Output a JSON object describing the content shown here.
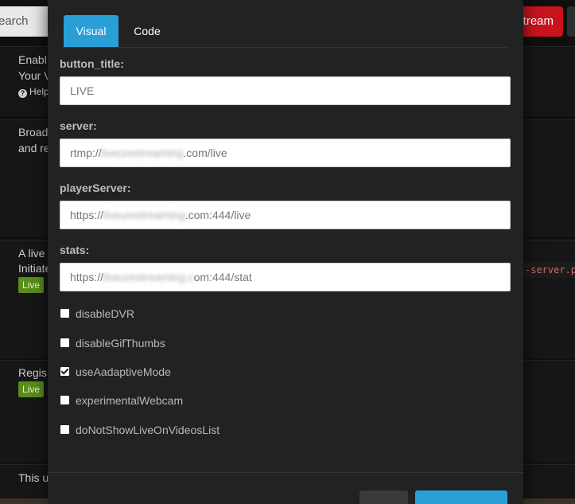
{
  "background": {
    "search_text": "earch",
    "stream_button": "tream",
    "panels": [
      {
        "lines": [
          "Enabl",
          "Your V"
        ],
        "help": "Help"
      },
      {
        "lines": [
          "Broad",
          "and re"
        ]
      },
      {
        "lines": [
          "A live",
          "Initiate"
        ],
        "badge": "Live"
      },
      {
        "lines": [
          "Regis"
        ],
        "badge": "Live"
      },
      {
        "lines": [
          "This u"
        ]
      }
    ],
    "code_snippet": "-server.p"
  },
  "modal": {
    "tabs": [
      {
        "label": "Visual",
        "active": true
      },
      {
        "label": "Code",
        "active": false
      }
    ],
    "fields": [
      {
        "label": "button_title:",
        "prefix": "LIVE",
        "blurred": "",
        "suffix": ""
      },
      {
        "label": "server:",
        "prefix": "rtmp://",
        "blurred": "liveurestreaming",
        "suffix": ".com/live"
      },
      {
        "label": "playerServer:",
        "prefix": "https://",
        "blurred": "liveurestreaming",
        "suffix": ".com:444/live"
      },
      {
        "label": "stats:",
        "prefix": "https://",
        "blurred": "liveurestreaming.c",
        "suffix": "om:444/stat"
      }
    ],
    "checkboxes": [
      {
        "label": "disableDVR",
        "checked": false
      },
      {
        "label": "disableGifThumbs",
        "checked": false
      },
      {
        "label": "useAadaptiveMode",
        "checked": true
      },
      {
        "label": "experimentalWebcam",
        "checked": false
      },
      {
        "label": "doNotShowLiveOnVideosList",
        "checked": false
      }
    ]
  },
  "colors": {
    "accent": "#2a9fd6",
    "danger": "#c9141e",
    "badge_green": "#5a8d1c"
  }
}
